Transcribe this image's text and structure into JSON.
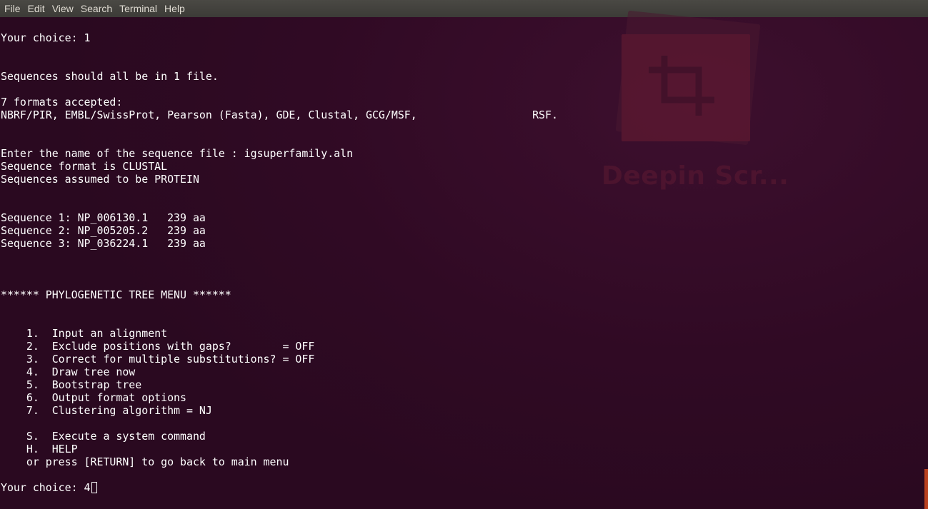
{
  "menubar": {
    "items": [
      {
        "name": "menu-file",
        "label": "File"
      },
      {
        "name": "menu-edit",
        "label": "Edit"
      },
      {
        "name": "menu-view",
        "label": "View"
      },
      {
        "name": "menu-search",
        "label": "Search"
      },
      {
        "name": "menu-terminal",
        "label": "Terminal"
      },
      {
        "name": "menu-help",
        "label": "Help"
      }
    ]
  },
  "watermark": {
    "text": "Deepin Scr..."
  },
  "terminal": {
    "lines": [
      "Your choice: 1",
      "",
      "",
      "Sequences should all be in 1 file.",
      "",
      "7 formats accepted:",
      "NBRF/PIR, EMBL/SwissProt, Pearson (Fasta), GDE, Clustal, GCG/MSF,                  RSF.",
      "",
      "",
      "Enter the name of the sequence file : igsuperfamily.aln",
      "Sequence format is CLUSTAL",
      "Sequences assumed to be PROTEIN",
      "",
      "",
      "Sequence 1: NP_006130.1   239 aa",
      "Sequence 2: NP_005205.2   239 aa",
      "Sequence 3: NP_036224.1   239 aa",
      "",
      "",
      "",
      "****** PHYLOGENETIC TREE MENU ******",
      "",
      "",
      "    1.  Input an alignment",
      "    2.  Exclude positions with gaps?        = OFF",
      "    3.  Correct for multiple substitutions? = OFF",
      "    4.  Draw tree now",
      "    5.  Bootstrap tree",
      "    6.  Output format options",
      "    7.  Clustering algorithm = NJ",
      "",
      "    S.  Execute a system command",
      "    H.  HELP",
      "    or press [RETURN] to go back to main menu",
      ""
    ],
    "prompt": "Your choice: ",
    "input_value": "4"
  },
  "colors": {
    "background": "#300a24",
    "menubar": "#3c3b37",
    "text": "#ffffff",
    "scrollbar": "#e95420"
  }
}
